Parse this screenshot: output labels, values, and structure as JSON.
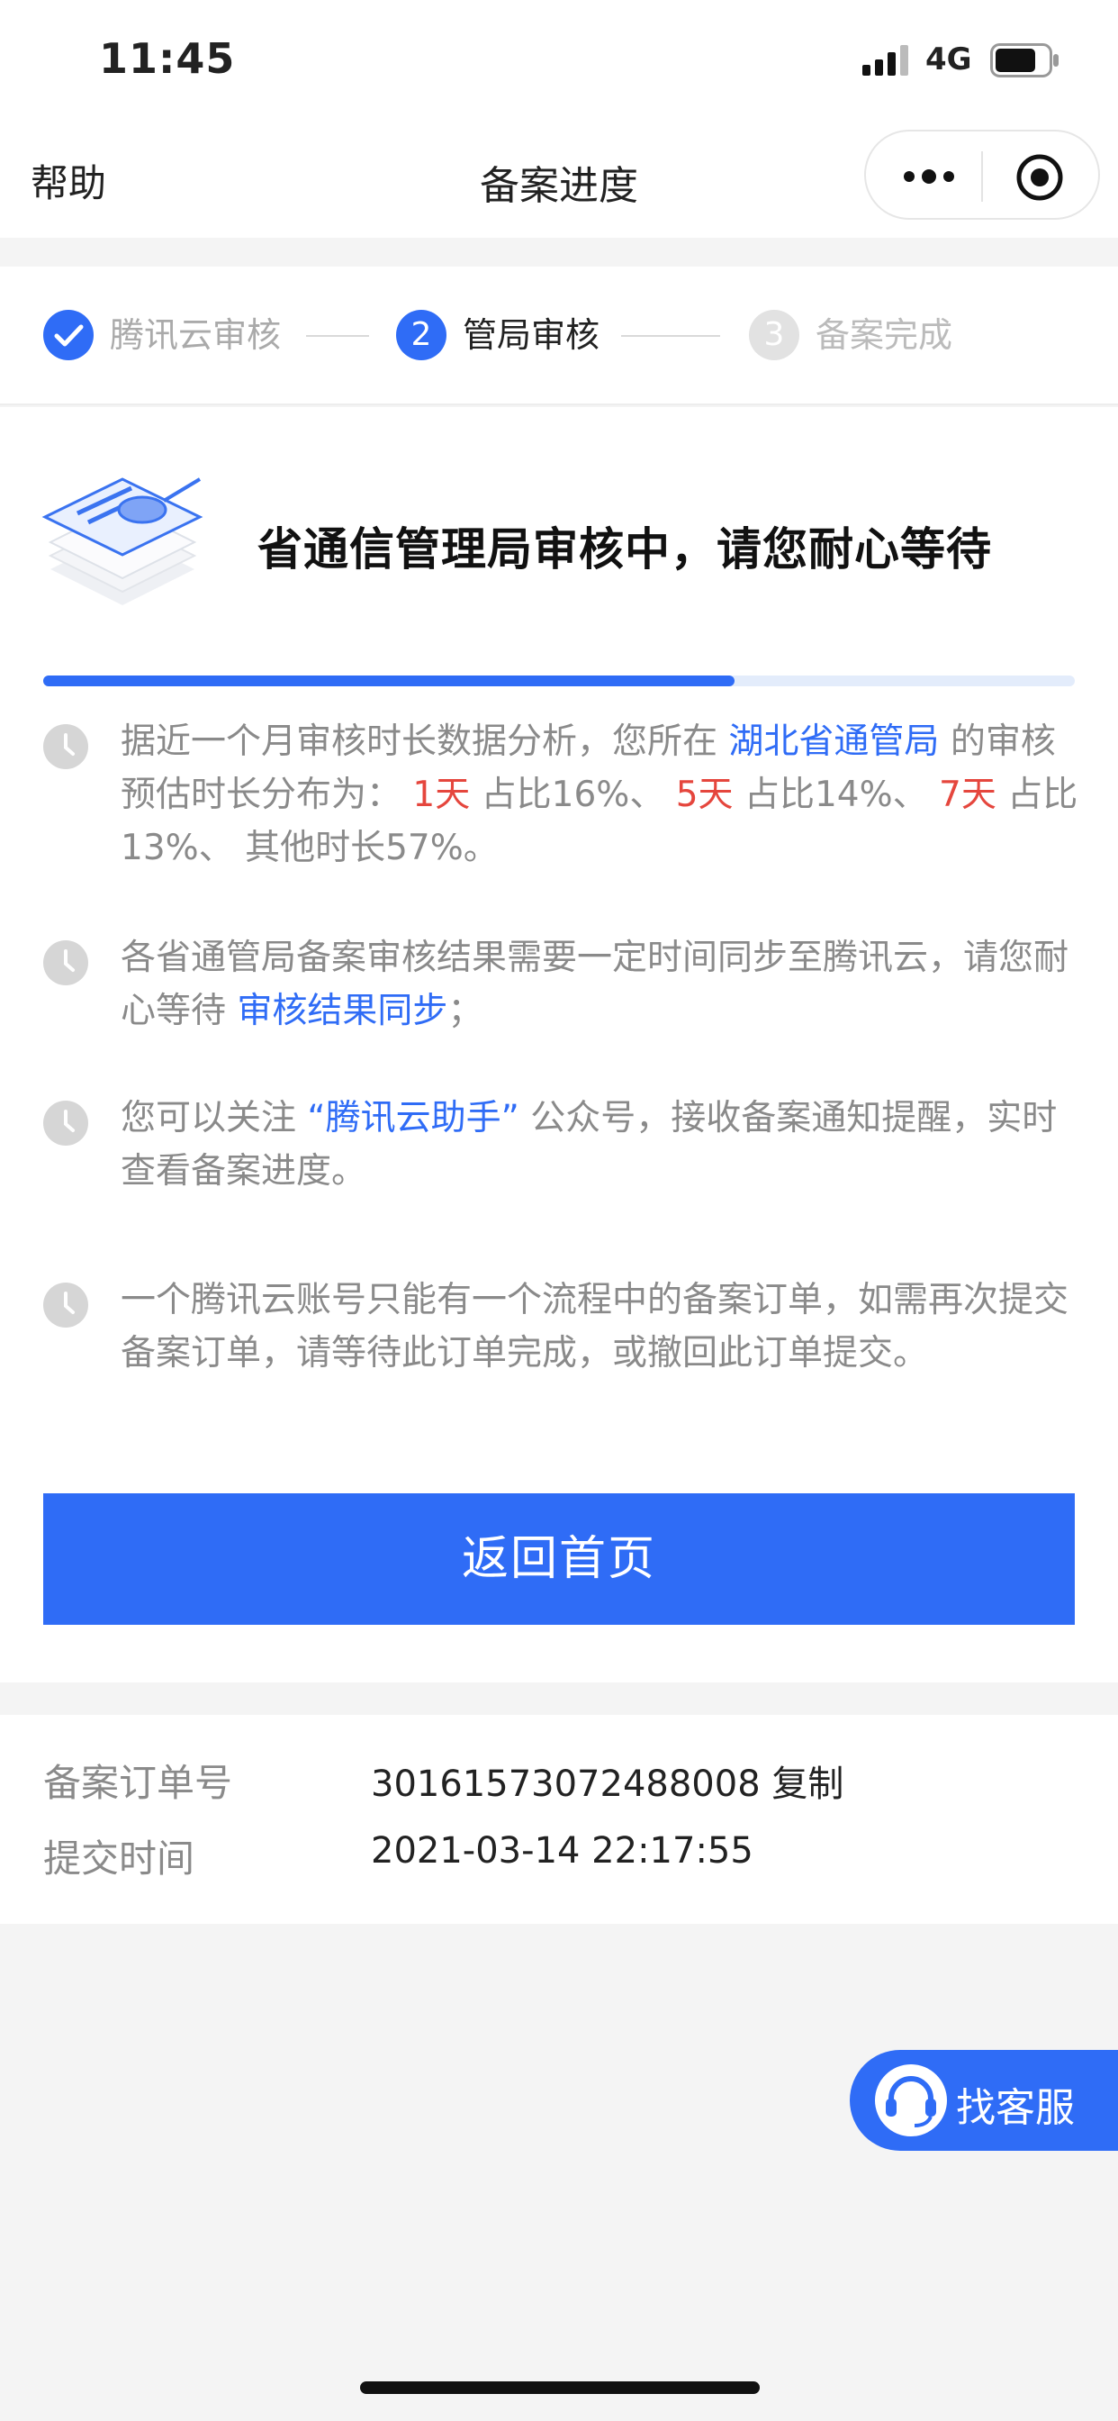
{
  "status_bar": {
    "time": "11:45",
    "network": "4G",
    "battery_level": 0.75
  },
  "nav": {
    "help": "帮助",
    "title": "备案进度"
  },
  "steps": [
    {
      "number": "",
      "label": "腾讯云审核",
      "state": "done"
    },
    {
      "number": "2",
      "label": "管局审核",
      "state": "active"
    },
    {
      "number": "3",
      "label": "备案完成",
      "state": "pending"
    }
  ],
  "headline": "省通信管理局审核中，请您耐心等待",
  "progress": 0.67,
  "tips": {
    "t1": {
      "a": "据近一个月审核时长数据分析，您所在 ",
      "link": "湖北省通管局",
      "b": " 的审核预估时长分布为：",
      "d1": "1天",
      "p1": " 占比16%、 ",
      "d2": "5天",
      "p2": " 占比14%、 ",
      "d3": "7天",
      "p3": " 占比13%、 其他时长57%。"
    },
    "t2": {
      "a": "各省通管局备案审核结果需要一定时间同步至腾讯云，请您耐心等待 ",
      "link": "审核结果同步",
      "b": "；"
    },
    "t3": {
      "a": "您可以关注 ",
      "link": "“腾讯云助手”",
      "b": " 公众号，接收备案通知提醒，实时查看备案进度。"
    },
    "t4": {
      "a": "一个腾讯云账号只能有一个流程中的备案订单，如需再次提交备案订单，请等待此订单完成，或撤回此订单提交。"
    }
  },
  "home_button": "返回首页",
  "order": {
    "number_label": "备案订单号",
    "number_value": "30161573072488008",
    "copy": "复制",
    "time_label": "提交时间",
    "time_value": "2021-03-14 22:17:55"
  },
  "customer_service": "找客服",
  "colors": {
    "primary": "#2f6cf6",
    "warning": "#e5463d",
    "muted": "#8a8a8a"
  }
}
